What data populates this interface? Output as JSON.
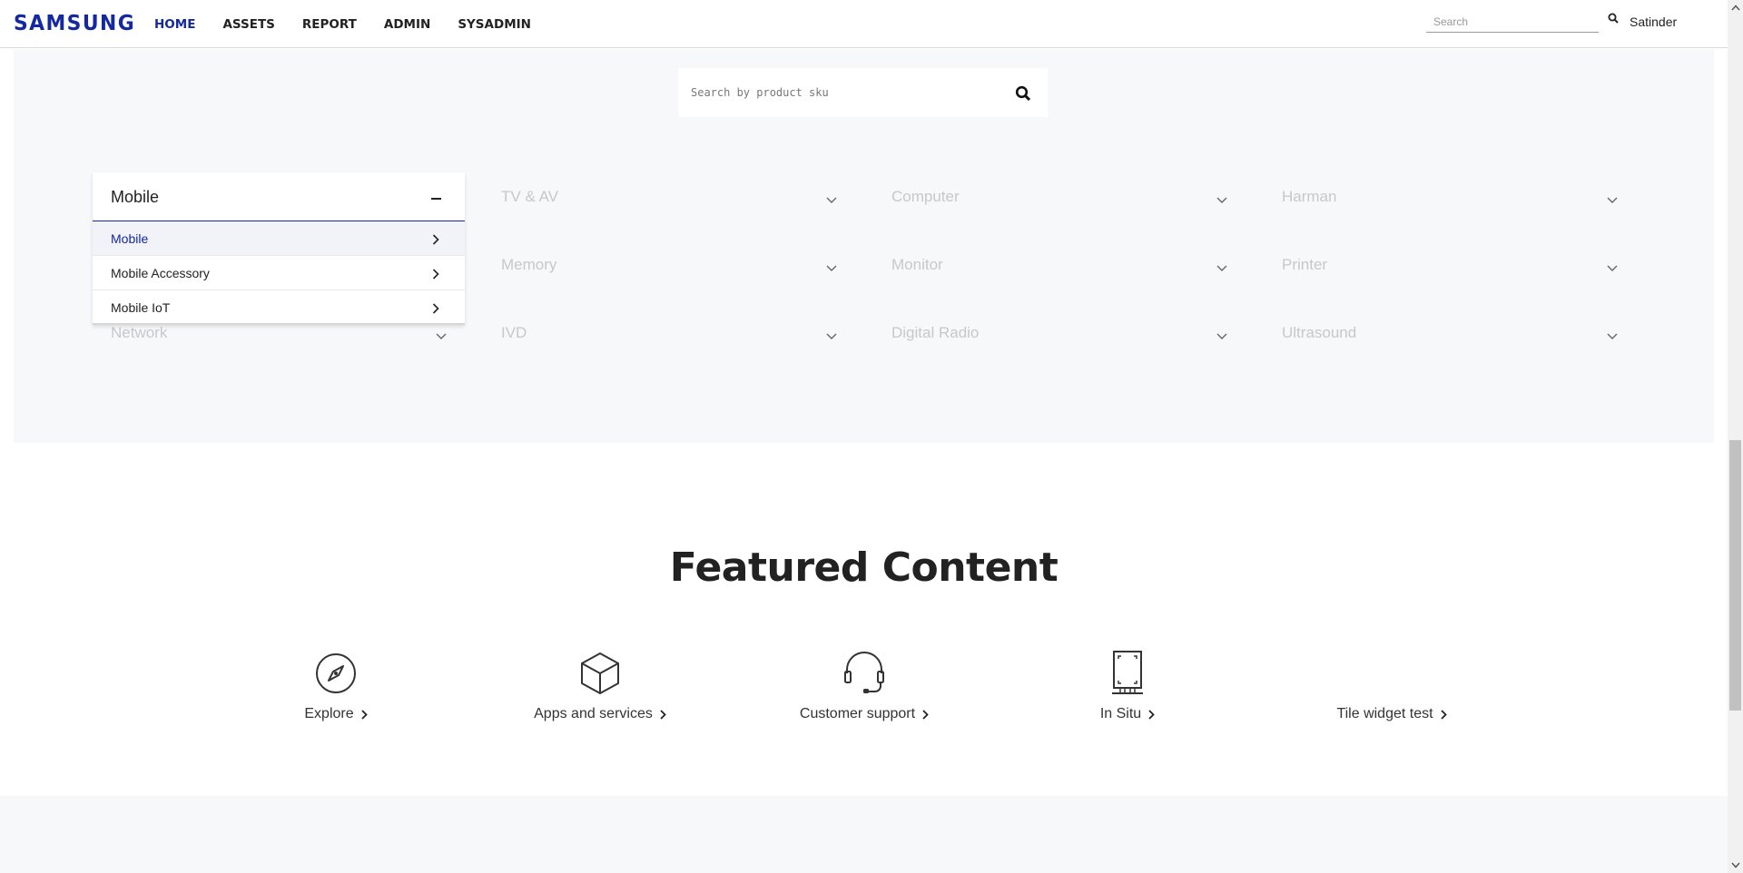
{
  "header": {
    "logo": "SAMSUNG",
    "nav": [
      "HOME",
      "ASSETS",
      "REPORT",
      "ADMIN",
      "SYSADMIN"
    ],
    "active_nav": "HOME",
    "search_placeholder": "Search",
    "user": "Satinder"
  },
  "sku_search": {
    "placeholder": "Search by product sku"
  },
  "categories": {
    "open": {
      "title": "Mobile",
      "items": [
        "Mobile",
        "Mobile Accessory",
        "Mobile IoT"
      ],
      "active_item": "Mobile"
    },
    "row1": [
      "TV & AV",
      "Computer",
      "Harman"
    ],
    "row2": [
      "Memory",
      "Monitor",
      "Printer"
    ],
    "row3": [
      "Network",
      "IVD",
      "Digital Radio",
      "Ultrasound"
    ]
  },
  "featured": {
    "title": "Featured Content",
    "tiles": [
      {
        "label": "Explore",
        "icon": "compass-icon"
      },
      {
        "label": "Apps and services",
        "icon": "box-icon"
      },
      {
        "label": "Customer support",
        "icon": "headset-icon"
      },
      {
        "label": "In Situ",
        "icon": "device-frame-icon"
      },
      {
        "label": "Tile widget test",
        "icon": ""
      }
    ]
  },
  "colors": {
    "brand": "#1428a0",
    "section_bg": "#f7f8fa"
  }
}
